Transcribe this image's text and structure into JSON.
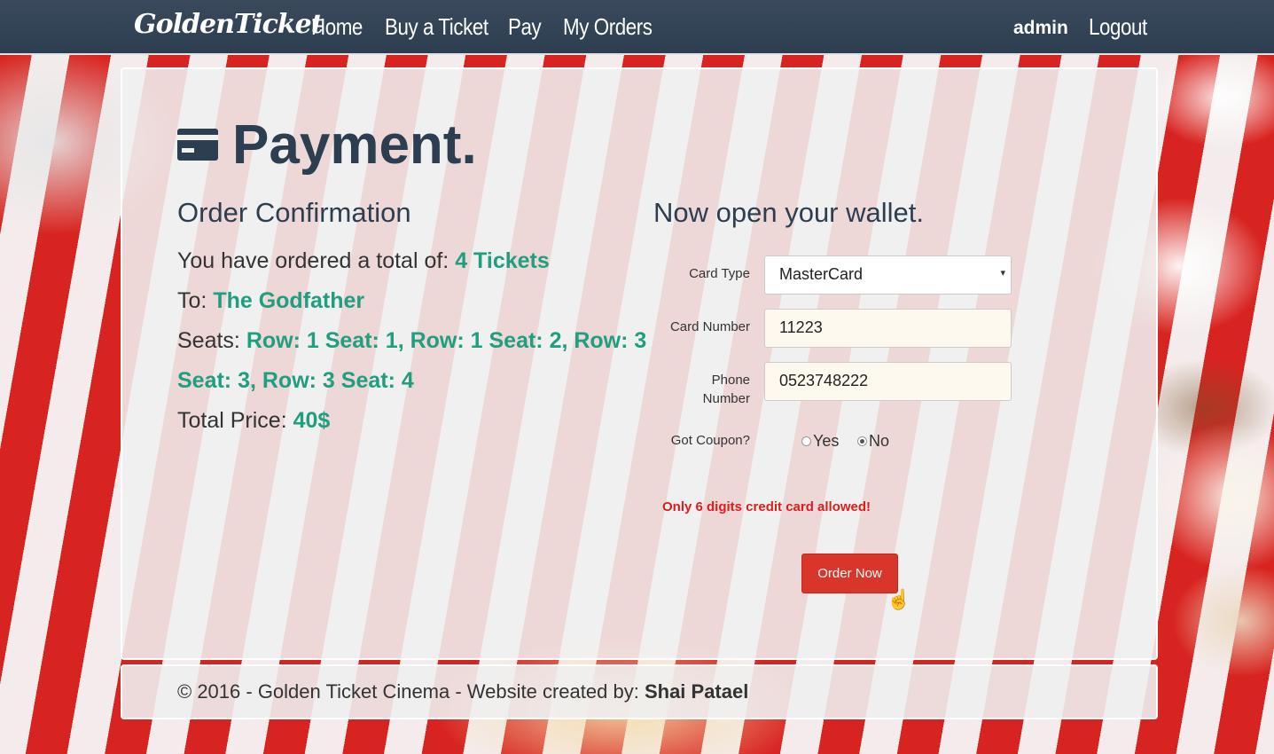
{
  "nav": {
    "brand": "GoldenTicket",
    "links": [
      "Home",
      "Buy a Ticket",
      "Pay",
      "My Orders"
    ],
    "user": "admin",
    "logout": "Logout"
  },
  "page": {
    "title": "Payment.",
    "title_icon": "credit-card-icon",
    "order_heading": "Order Confirmation",
    "wallet_heading": "Now open your wallet."
  },
  "order": {
    "total_label": "You have ordered a total of:",
    "total_value": "4 Tickets",
    "to_label": "To:",
    "to_value": "The Godfather",
    "seats_label": "Seats:",
    "seats_value_line1": "Row: 1 Seat: 1, Row: 1 Seat: 2, Row: 3",
    "seats_value_line2": "Seat: 3, Row: 3 Seat: 4",
    "price_label": "Total Price:",
    "price_value": "40$"
  },
  "form": {
    "card_type_label": "Card Type",
    "card_type_value": "MasterCard",
    "card_number_label": "Card Number",
    "card_number_value": "11223",
    "phone_label_line1": "Phone",
    "phone_label_line2": "Number",
    "phone_value": "0523748222",
    "coupon_label": "Got Coupon?",
    "coupon_yes": "Yes",
    "coupon_no": "No",
    "coupon_selected": "No",
    "error": "Only 6 digits credit card allowed!",
    "submit": "Order Now"
  },
  "footer": {
    "text": "© 2016 - Golden Ticket Cinema - Website created by:",
    "author": "Shai Patael"
  },
  "colors": {
    "navbar": "#2c3e50",
    "highlight": "#1f9e80",
    "button": "#d9352b",
    "error": "#e01b1b"
  }
}
